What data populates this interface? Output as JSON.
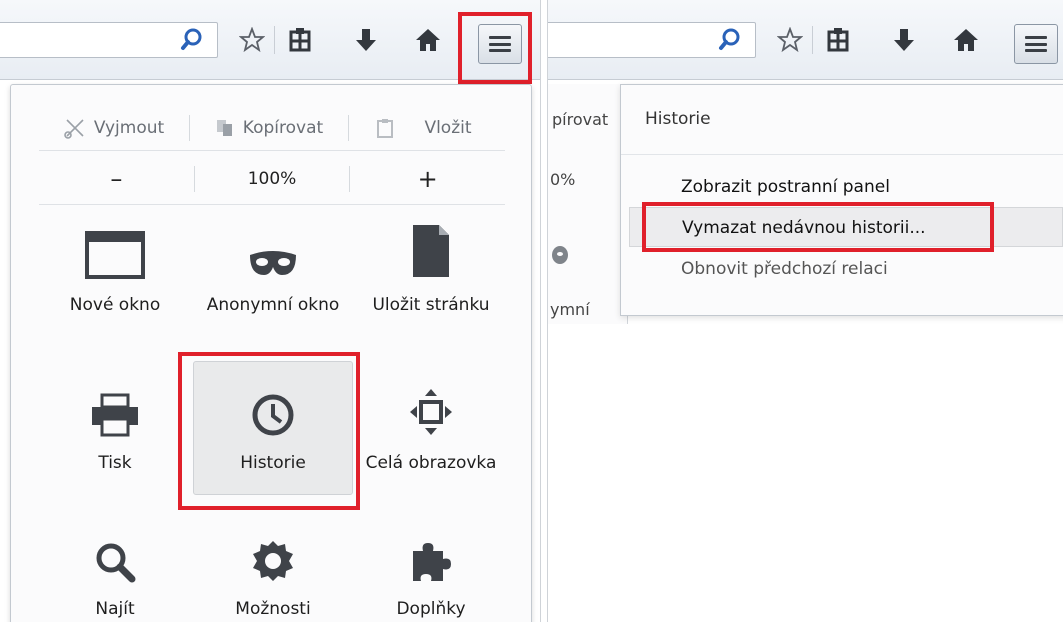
{
  "left": {
    "edit_row": {
      "cut": "Vyjmout",
      "copy": "Kopírovat",
      "paste": "Vložit"
    },
    "zoom_row": {
      "minus": "–",
      "level": "100%",
      "plus": "+"
    },
    "grid": [
      {
        "label": "Nové okno",
        "icon": "new-window-icon"
      },
      {
        "label": "Anonymní okno",
        "icon": "private-mask-icon"
      },
      {
        "label": "Uložit stránku",
        "icon": "save-page-icon"
      },
      {
        "label": "Tisk",
        "icon": "print-icon"
      },
      {
        "label": "Historie",
        "icon": "history-clock-icon"
      },
      {
        "label": "Celá obrazovka",
        "icon": "fullscreen-icon"
      },
      {
        "label": "Najít",
        "icon": "find-icon"
      },
      {
        "label": "Možnosti",
        "icon": "options-gear-icon"
      },
      {
        "label": "Doplňky",
        "icon": "addons-puzzle-icon"
      }
    ]
  },
  "right": {
    "partial": {
      "copy_fragment": "pírovat",
      "zoom_fragment": "0%",
      "private_fragment": "ymní"
    },
    "history_panel": {
      "title": "Historie",
      "items": [
        "Zobrazit postranní panel",
        "Vymazat nedávnou historii...",
        "Obnovit předchozí relaci"
      ]
    }
  },
  "colors": {
    "highlight": "#e0202b",
    "icon": "#3f4349"
  }
}
